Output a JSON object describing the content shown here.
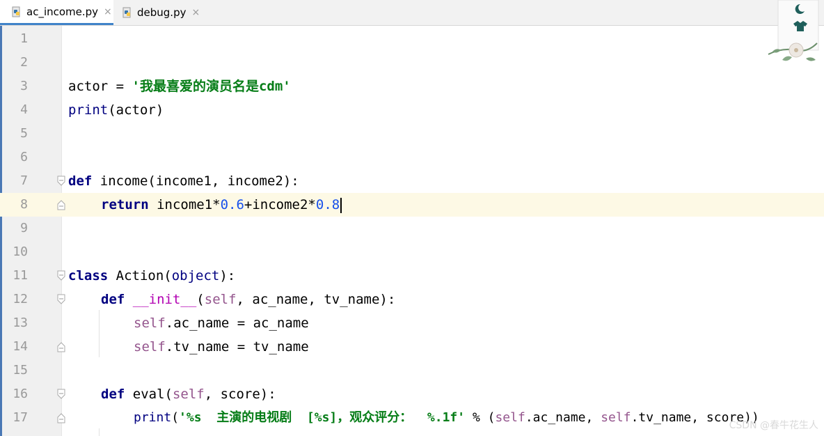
{
  "tabs": [
    {
      "label": "ac_income.py",
      "close": "×",
      "active": true
    },
    {
      "label": "debug.py",
      "close": "×",
      "active": false
    }
  ],
  "lines": [
    {
      "n": "1"
    },
    {
      "n": "2"
    },
    {
      "n": "3"
    },
    {
      "n": "4"
    },
    {
      "n": "5"
    },
    {
      "n": "6"
    },
    {
      "n": "7"
    },
    {
      "n": "8"
    },
    {
      "n": "9"
    },
    {
      "n": "10"
    },
    {
      "n": "11"
    },
    {
      "n": "12"
    },
    {
      "n": "13"
    },
    {
      "n": "14"
    },
    {
      "n": "15"
    },
    {
      "n": "16"
    },
    {
      "n": "17"
    }
  ],
  "code": {
    "l3": {
      "a": "actor = ",
      "b": "'我最喜爱的演员名是cdm'"
    },
    "l4": {
      "a": "print",
      "b": "(actor)"
    },
    "l7": {
      "kw": "def",
      "b": " income(income1, income2):"
    },
    "l8": {
      "kw": "return",
      "b": " income1*",
      "n1": "0.6",
      "c": "+income2*",
      "n2": "0.8"
    },
    "l11": {
      "kw": "class",
      "b": " Action(",
      "obj": "object",
      "c": "):"
    },
    "l12": {
      "kw": "def",
      "sp": " ",
      "fn": "__init__",
      "p1": "(",
      "self": "self",
      "rest": ", ac_name, tv_name):"
    },
    "l13": {
      "self": "self",
      "rest": ".ac_name = ac_name"
    },
    "l14": {
      "self": "self",
      "rest": ".tv_name = tv_name"
    },
    "l16": {
      "kw": "def",
      "b": " eval(",
      "self": "self",
      "rest": ", score):"
    },
    "l17": {
      "print": "print",
      "p1": "(",
      "str": "'%s  主演的电视剧  [%s]，观众评分：  %.1f'",
      "op": " % (",
      "self1": "self",
      "m": ".ac_name, ",
      "self2": "self",
      "r": ".tv_name, score))"
    }
  },
  "watermark": "CSDN @春牛花生人",
  "colors": {
    "keyword": "#000080",
    "string": "#067d17",
    "number": "#1750eb",
    "self": "#94558d",
    "current_line": "#fdf9e5",
    "tab_underline": "#4083c9"
  }
}
